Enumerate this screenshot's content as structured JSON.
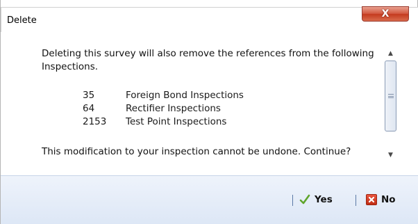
{
  "window": {
    "title": "Delete",
    "close_label": "X"
  },
  "message": {
    "intro": "Deleting this survey will also remove the references from the following Inspections.",
    "items": [
      {
        "id": "35",
        "name": "Foreign Bond Inspections"
      },
      {
        "id": "64",
        "name": "Rectifier Inspections"
      },
      {
        "id": "2153",
        "name": "Test Point Inspections"
      }
    ],
    "confirm": "This modification to your inspection cannot be undone. Continue?"
  },
  "buttons": {
    "yes_label": "Yes",
    "no_label": "No"
  },
  "icons": {
    "close": "close-icon",
    "yes": "checkmark-icon",
    "no": "x-icon",
    "scroll_up": "arrow-up-icon",
    "scroll_down": "arrow-down-icon"
  },
  "colors": {
    "close_button": "#d2583f",
    "button_bar": "#dde7f6",
    "check_green": "#5fa52b",
    "no_red": "#c02d15"
  }
}
